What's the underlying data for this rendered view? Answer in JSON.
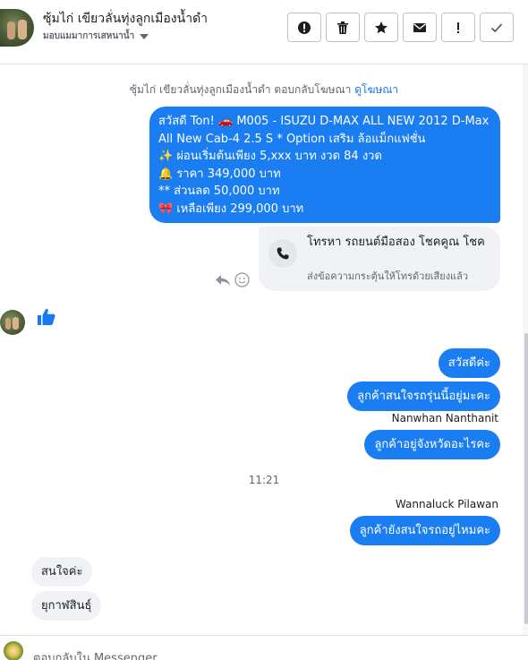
{
  "header": {
    "title": "ซุ้มไก่ เขียวลั่นทุ่งลูกเมืองน้ำดำ",
    "subtitle": "มอบแมมาการเสหนาน้ำ",
    "toolbar": [
      {
        "name": "report-button",
        "icon": "alert-circle-icon"
      },
      {
        "name": "delete-button",
        "icon": "trash-icon"
      },
      {
        "name": "star-button",
        "icon": "star-icon"
      },
      {
        "name": "mark-unread-button",
        "icon": "envelope-icon"
      },
      {
        "name": "important-button",
        "icon": "exclamation-icon"
      },
      {
        "name": "done-button",
        "icon": "check-icon"
      }
    ]
  },
  "notice": {
    "text": "ซุ้มไก่ เขียวลั่นทุ่งลูกเมืองน้ำดำ ตอบกลับโฆษณา",
    "link": "ดูโฆษณา"
  },
  "ad_message": {
    "lines": [
      "สวัสดี Ton! 🚗 M005 - ISUZU D-MAX ALL NEW 2012 D-Max",
      "All New Cab-4 2.5 S  * Option เสริม ล้อแม็กแฟชั่น",
      "✨ ผ่อนเริ่มต้นเพียง 5,xxx บาท งวด 84 งวด",
      "🔔  ราคา 349,000 บาท",
      "** ส่วนลด 50,000 บาท",
      "🎀 เหลือเพียง 299,000 บาท"
    ]
  },
  "call_card": {
    "title": "โทรหา รถยนต์มือสอง โชคคูณ โชค",
    "subtitle": "ส่งข้อความกระตุ้นให้โทรด้วยเสียงแล้ว",
    "icon": "phone-icon"
  },
  "messages_out": [
    {
      "text": "สวัสดีค่ะ"
    },
    {
      "text": "ลูกค้าสนใจรถรุ่นนี้อยู่มะคะ"
    },
    {
      "text": "ลูกค้าอยู่จังหวัดอะไรคะ"
    },
    {
      "text": "ลูกค้ายังสนใจรถอยู่ไหมคะ"
    }
  ],
  "sender_labels": {
    "first": "Nanwhan Nanthanit",
    "second": "Wannaluck Pilawan"
  },
  "time_separator": "11:21",
  "messages_in": [
    {
      "text": "สนใจค่ะ"
    },
    {
      "text": "ยุกาฬสินธุ์"
    }
  ],
  "footer": {
    "placeholder": "ตอบกลับใน Messenger..."
  },
  "colors": {
    "outgoing_bubble": "#1a7ef2",
    "incoming_bubble": "#f0f2f5",
    "link": "#1877f2"
  }
}
